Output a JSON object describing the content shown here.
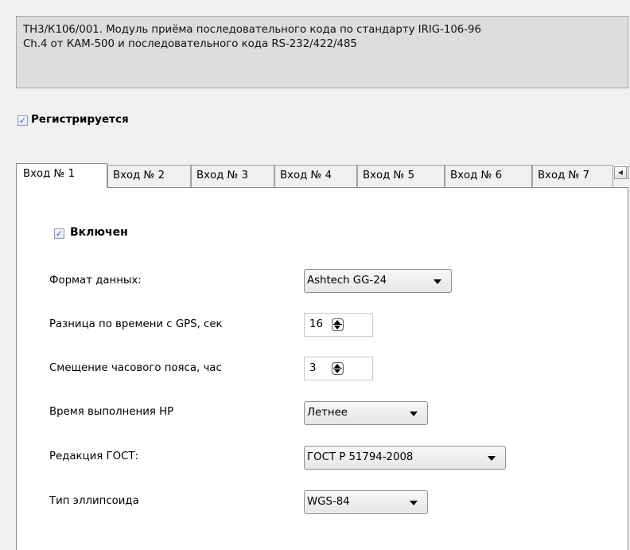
{
  "description": {
    "line1": "ТН3/К106/001. Модуль приёма последовательного кода по стандарту IRIG-106-96",
    "line2": "Ch.4 от КАМ-500 и последовательного кода RS-232/422/485"
  },
  "registered": {
    "label": "Регистрируется",
    "checked": true
  },
  "tabs": [
    {
      "label": "Вход № 1",
      "active": true
    },
    {
      "label": "Вход № 2"
    },
    {
      "label": "Вход № 3"
    },
    {
      "label": "Вход № 4"
    },
    {
      "label": "Вход № 5"
    },
    {
      "label": "Вход № 6"
    },
    {
      "label": "Вход № 7"
    }
  ],
  "tab_scroll": {
    "left_icon": "scroll-left-icon",
    "right_icon": "scroll-right-icon"
  },
  "input": {
    "enabled": {
      "label": "Включен",
      "checked": true
    },
    "data_format": {
      "label": "Формат данных:",
      "value": "Ashtech GG-24"
    },
    "gps_time_diff": {
      "label": "Разница по времени с GPS, сек",
      "value": "16"
    },
    "tz_offset": {
      "label": "Смещение часового пояса, час",
      "value": "3"
    },
    "np_time": {
      "label": "Время выполнения НР",
      "value": "Летнее"
    },
    "gost": {
      "label": "Редакция ГОСТ:",
      "value": "ГОСТ Р 51794-2008"
    },
    "ellipsoid": {
      "label": "Тип эллипсоида",
      "value": "WGS-84"
    }
  },
  "colors": {
    "checkmark": "#2a5fd6",
    "panel_bg": "#ffffff",
    "window_bg": "#f0f0f0",
    "desc_bg": "#dddddd"
  }
}
